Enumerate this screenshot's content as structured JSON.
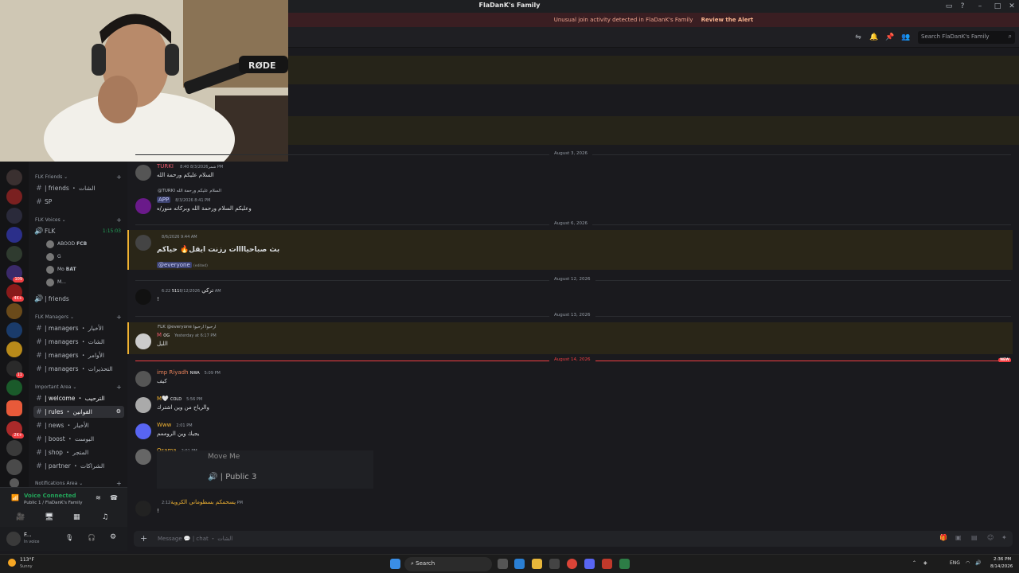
{
  "title_bar": {
    "title": "FlaDanK's Family"
  },
  "alert": {
    "text": "Unusual join activity detected in FlaDanK's Family",
    "link": "Review the Alert"
  },
  "header": {
    "search_placeholder": "Search FlaDanK's Family"
  },
  "sidebar": {
    "categories": [
      "FLK Friends",
      "FLK Voices",
      "FLK Managers",
      "Important Area",
      "Notifications Area"
    ],
    "friends_channels": [
      {
        "label": "| friends ・ الشات"
      },
      {
        "label": "SP"
      }
    ],
    "voice_channel": {
      "label": "FLK",
      "timer": "1:15:03"
    },
    "voice_users": [
      {
        "name": "ABOOD",
        "tag": "FCB"
      },
      {
        "name": "G",
        "tag": ""
      },
      {
        "name": "Mo",
        "tag": "BAT"
      },
      {
        "name": "M...",
        "tag": ""
      }
    ],
    "voice_channel_2": {
      "label": "| friends"
    },
    "manager_channels": [
      {
        "label": "| managers ・ الأخبار"
      },
      {
        "label": "| managers ・ الشات"
      },
      {
        "label": "| managers ・ الأوامر"
      },
      {
        "label": "| managers ・ التحذيرات"
      }
    ],
    "important_channels": [
      {
        "label": "| welcome ・ الترحيب"
      },
      {
        "label": "| rules ・ القوانين"
      },
      {
        "label": "| news ・ الأخبار"
      },
      {
        "label": "| boost ・ البوست"
      },
      {
        "label": "| shop ・ المتجر"
      },
      {
        "label": "| partner ・ الشراكات"
      }
    ]
  },
  "voice_panel": {
    "status": "Voice Connected",
    "channel": "Public 1 / FlaDanK's Family"
  },
  "user_panel": {
    "name": "F...",
    "status": "In voice"
  },
  "servers": {
    "badges": [
      "109",
      "4K+",
      "11",
      "2K+"
    ]
  },
  "chat": {
    "dates": [
      "August 3, 2026",
      "August 6, 2026",
      "August 12, 2026",
      "August 13, 2026",
      "August 14, 2026"
    ],
    "new_label": "NEW",
    "messages": [
      {
        "name": "TURKI",
        "tag": "شمر",
        "time": "8/3/2026 8:40 PM",
        "text": "السلام عليكم ورحمة الله"
      },
      {
        "name": "APP",
        "time": "8/3/2026 8:41 PM",
        "reply": "@TURKI السلام عليكم ورحمة الله",
        "text": "وعليكم السلام ورحمة الله وبركاته منور/ه"
      },
      {
        "name": "",
        "time": "8/6/2026 9:44 AM",
        "text": "بث صباحياااات رزنت ايقل🔥 حياكم",
        "mention": "@everyone",
        "edited": "(edited)"
      },
      {
        "name": "تركي",
        "tag": "511",
        "time": "8/12/2026 6:22 AM",
        "text": "!"
      },
      {
        "name": "M",
        "tag": "OG",
        "time": "Yesterday at 6:17 PM",
        "reply": "FLK @everyone ارحبوا ارحبوا",
        "text": "الليل"
      },
      {
        "name": "imp Riyadh",
        "tag": "NWA",
        "time": "5:09 PM",
        "text": "كيف"
      },
      {
        "name": "M🤍",
        "tag": "COLD",
        "time": "5:56 PM",
        "text": "والرياح من وين اشترك"
      },
      {
        "name": "Www",
        "time": "2:01 PM",
        "text": "يجيك وين الروممم"
      },
      {
        "name": "Osama",
        "time": "2:01 PM",
        "text": ""
      },
      {
        "name": "يسحمكم بسطوماني الكروية",
        "time": "2:12 PM",
        "text": "!"
      }
    ],
    "overlay": {
      "line1": "Move Me",
      "line2": "| Public 3"
    }
  },
  "input": {
    "placeholder": "Message 💬 | chat ・ الشات"
  },
  "taskbar": {
    "weather_temp": "113°F",
    "weather_desc": "Sunny",
    "search": "Search",
    "lang": "ENG",
    "time": "2:36 PM",
    "date": "8/14/2026"
  }
}
